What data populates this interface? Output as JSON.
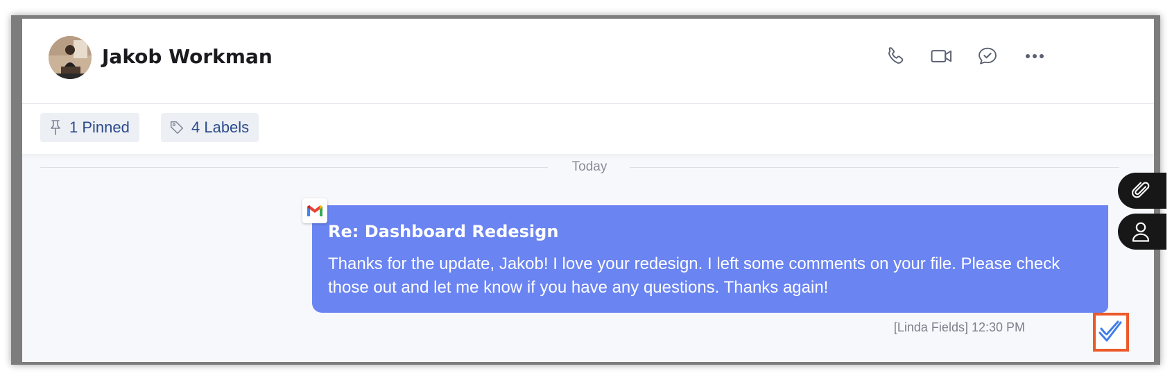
{
  "contact": {
    "name": "Jakob Workman",
    "avatar_icon": "user-photo-avatar"
  },
  "header_actions": [
    {
      "name": "call",
      "icon": "phone-icon"
    },
    {
      "name": "video",
      "icon": "video-camera-icon"
    },
    {
      "name": "chat",
      "icon": "chat-check-icon"
    },
    {
      "name": "more",
      "icon": "more-dots-icon"
    }
  ],
  "toolbar": {
    "pinned_label": "1 Pinned",
    "labels_label": "4 Labels"
  },
  "timeline": {
    "divider_label": "Today"
  },
  "message": {
    "source_icon": "gmail-icon",
    "subject": "Re: Dashboard Redesign",
    "body": "Thanks for the update, Jakob! I love your redesign. I left some comments on your file. Please check those out and let me know if you have any questions. Thanks again!",
    "meta": "[Linda Fields] 12:30 PM",
    "status_icon": "double-check-icon"
  },
  "side_actions": [
    {
      "name": "attachments",
      "icon": "paperclip-icon"
    },
    {
      "name": "contact",
      "icon": "person-icon"
    }
  ],
  "colors": {
    "bubble": "#6a84f1",
    "chip_bg": "#eceff4",
    "chip_text": "#2b4a8a",
    "highlight": "#ec5a2a",
    "read_check": "#3f7ee8"
  }
}
